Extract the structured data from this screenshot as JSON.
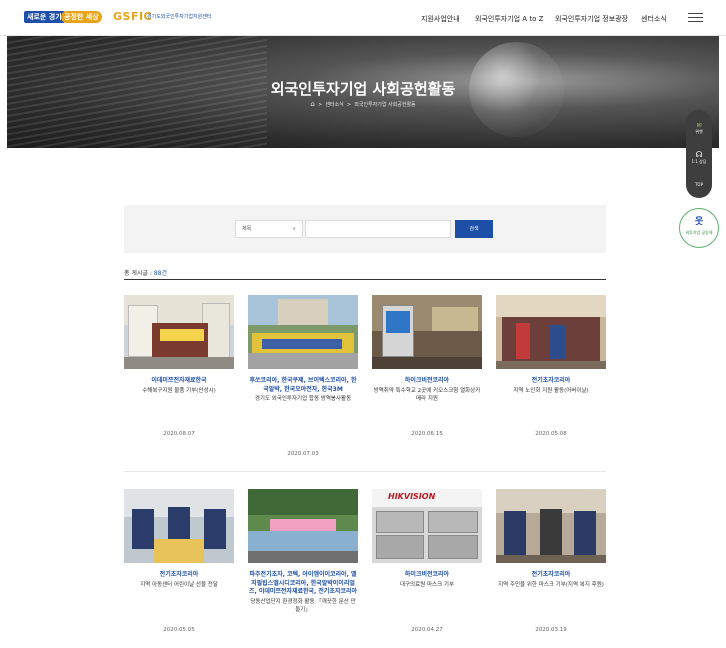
{
  "header": {
    "badge_1": "새로운 경기",
    "badge_2": "공정한 세상",
    "logo": "GSFIC",
    "logo_org": "경기도외국인투자기업지원센터",
    "nav": [
      "지원사업안내",
      "외국인투자기업 A to Z",
      "외국인투자기업 정보광장",
      "센터소식"
    ],
    "menu_icon": "hamburger-icon"
  },
  "hero": {
    "title": "외국인투자기업 사회공헌활동",
    "breadcrumb": [
      "센터소식",
      "외국인투자기업 사회공헌활동"
    ],
    "home_icon": "home-icon"
  },
  "side": {
    "items": [
      "위챗",
      "1:1 상담",
      "TOP"
    ],
    "circle_label": "외투기업 공동체"
  },
  "search": {
    "select_value": "제목",
    "input_value": "",
    "button_label": "검색"
  },
  "total": {
    "label": "총 게시글 : ",
    "count": "88건"
  },
  "cards": [
    {
      "company": "이데미쯔전자재료한국",
      "desc": "수해복구지원 물품 기부(안성시)",
      "date": "2020.08.07"
    },
    {
      "company": "후쏘코리아, 한국쿠제, 브이텍스코리아, 한국알박, 한국오야전자, 한국3M",
      "desc": "경기도 외국인투자기업 합동 방역봉사활동",
      "date": "2020.07.03"
    },
    {
      "company": "하이크비전코리아",
      "desc": "방역취약 특수학교 2곳에 키오스크형 열화상카메라 지원",
      "date": "2020.06.15"
    },
    {
      "company": "전기초자코리아",
      "desc": "지역 노인회 지원 활동(어버이날)",
      "date": "2020.05.08"
    },
    {
      "company": "전기초자코리아",
      "desc": "지역 아동센터 어린이날 선물 전달",
      "date": "2020.05.05"
    },
    {
      "company": "파주전기초자, 코텍, 아이엠이이코리아, 엘지필립스엘시디코리아, 한국알박이이리얼즈, 이데미쯔전자재료한국, 전기초자코리아",
      "desc": "당동산업단지 환경정화 활동 「깨끗한 문산 만들기」",
      "date": "2020.04.27"
    },
    {
      "company": "하이크비전코리아",
      "desc": "대구의료원 마스크 기부",
      "date": "2020.04.27"
    },
    {
      "company": "전기초자코리아",
      "desc": "지역 주민을 위한 마스크 기부(지역 복지 후원)",
      "date": "2020.03.19"
    }
  ],
  "colors": {
    "accent": "#1d4fa8",
    "highlight": "#e8a317",
    "green": "#2e8b3d"
  }
}
